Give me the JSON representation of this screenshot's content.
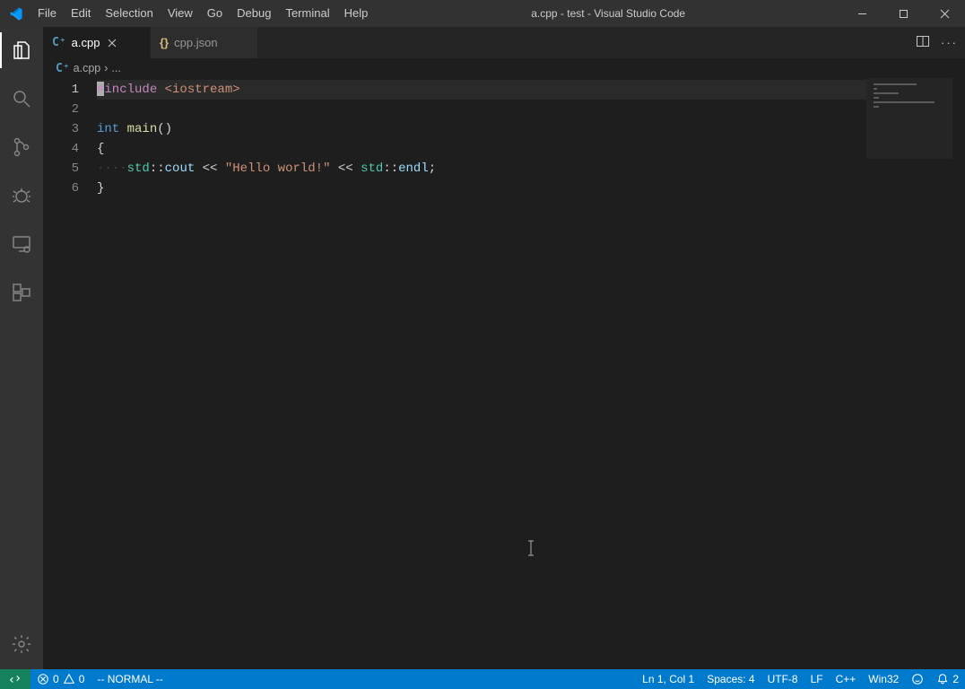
{
  "title": "a.cpp - test - Visual Studio Code",
  "menu": {
    "items": [
      "File",
      "Edit",
      "Selection",
      "View",
      "Go",
      "Debug",
      "Terminal",
      "Help"
    ]
  },
  "activity": {
    "explorer": "Explorer",
    "search": "Search",
    "scm": "Source Control",
    "debug": "Debug",
    "remote": "Remote",
    "extensions": "Extensions",
    "settings": "Settings"
  },
  "tabs": [
    {
      "label": "a.cpp",
      "icon": "cpp",
      "active": true,
      "dirty": false
    },
    {
      "label": "cpp.json",
      "icon": "json",
      "active": false,
      "dirty": false
    }
  ],
  "breadcrumb": {
    "file": "a.cpp",
    "rest": "..."
  },
  "code": {
    "lines": [
      {
        "n": 1,
        "tokens": [
          {
            "t": "#",
            "c": "preproc",
            "cursor": true
          },
          {
            "t": "include ",
            "c": "preproc"
          },
          {
            "t": "<iostream>",
            "c": "angled"
          }
        ]
      },
      {
        "n": 2,
        "tokens": []
      },
      {
        "n": 3,
        "tokens": [
          {
            "t": "int ",
            "c": "keyword"
          },
          {
            "t": "main",
            "c": "func"
          },
          {
            "t": "()",
            "c": "punc"
          }
        ]
      },
      {
        "n": 4,
        "tokens": [
          {
            "t": "{",
            "c": "punc"
          }
        ]
      },
      {
        "n": 5,
        "tokens": [
          {
            "t": "····",
            "c": "fade"
          },
          {
            "t": "std",
            "c": "ns"
          },
          {
            "t": "::",
            "c": "punc"
          },
          {
            "t": "cout",
            "c": "ident"
          },
          {
            "t": " << ",
            "c": "punc"
          },
          {
            "t": "\"Hello world!\"",
            "c": "string"
          },
          {
            "t": " << ",
            "c": "punc"
          },
          {
            "t": "std",
            "c": "ns"
          },
          {
            "t": "::",
            "c": "punc"
          },
          {
            "t": "endl",
            "c": "ident"
          },
          {
            "t": ";",
            "c": "punc"
          }
        ]
      },
      {
        "n": 6,
        "tokens": [
          {
            "t": "}",
            "c": "punc"
          }
        ]
      }
    ],
    "current_line": 1
  },
  "status": {
    "errors": "0",
    "warnings": "0",
    "vim_mode": "-- NORMAL --",
    "cursor": "Ln 1, Col 1",
    "indent": "Spaces: 4",
    "encoding": "UTF-8",
    "eol": "LF",
    "language": "C++",
    "platform": "Win32",
    "notifications": "2"
  }
}
